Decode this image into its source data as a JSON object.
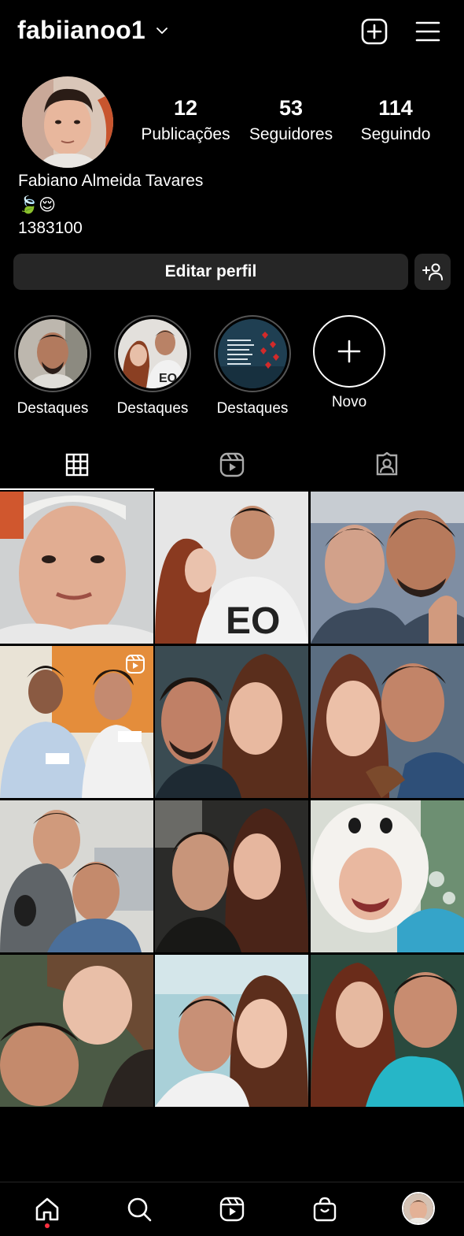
{
  "header": {
    "username": "fabiianoo1",
    "icons": [
      "chevron-down-icon",
      "new-post-icon",
      "menu-icon"
    ]
  },
  "profile": {
    "stats": [
      {
        "value": "12",
        "label": "Publicações"
      },
      {
        "value": "53",
        "label": "Seguidores"
      },
      {
        "value": "114",
        "label": "Seguindo"
      }
    ],
    "full_name": "Fabiano Almeida Tavares",
    "bio_emoji": "🍃😌",
    "bio_line": "1383100",
    "edit_label": "Editar perfil"
  },
  "highlights": [
    {
      "label": "Destaques"
    },
    {
      "label": "Destaques"
    },
    {
      "label": "Destaques"
    },
    {
      "label": "Novo"
    }
  ],
  "tabs": [
    "grid-tab",
    "reels-tab",
    "tagged-tab"
  ],
  "grid": {
    "cells": 12,
    "reel_badge_index": 3
  },
  "bottom_nav": [
    "home-icon",
    "search-icon",
    "reels-icon",
    "shop-icon",
    "profile-avatar"
  ],
  "colors": {
    "background": "#000000",
    "button_bg": "#262626",
    "notification_dot": "#ff3040"
  }
}
